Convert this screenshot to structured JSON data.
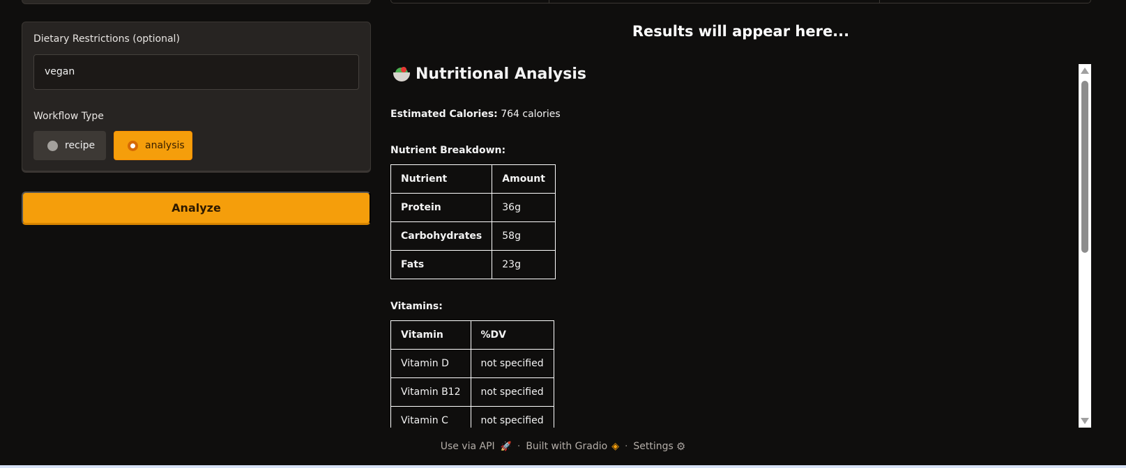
{
  "form": {
    "dietary_label": "Dietary Restrictions (optional)",
    "dietary_value": "vegan",
    "workflow_label": "Workflow Type",
    "workflow_options": [
      "recipe",
      "analysis"
    ],
    "workflow_selected": "analysis",
    "analyze_label": "Analyze"
  },
  "results": {
    "heading": "Results will appear here...",
    "title": "Nutritional Analysis",
    "calories_label": "Estimated Calories:",
    "calories_value": "764 calories",
    "nutrients_label": "Nutrient Breakdown:",
    "nutrients_headers": [
      "Nutrient",
      "Amount"
    ],
    "nutrients_rows": [
      [
        "Protein",
        "36g"
      ],
      [
        "Carbohydrates",
        "58g"
      ],
      [
        "Fats",
        "23g"
      ]
    ],
    "vitamins_label": "Vitamins:",
    "vitamins_headers": [
      "Vitamin",
      "%DV"
    ],
    "vitamins_rows": [
      [
        "Vitamin D",
        "not specified"
      ],
      [
        "Vitamin B12",
        "not specified"
      ],
      [
        "Vitamin C",
        "not specified"
      ]
    ]
  },
  "footer": {
    "api_label": "Use via API",
    "built_label": "Built with Gradio",
    "settings_label": "Settings",
    "separator": "·"
  },
  "colors": {
    "accent": "#f59e0b",
    "background": "#0f0e0d",
    "panel": "#272422"
  },
  "icons": {
    "title_icon": "salad-bowl-icon",
    "api_icon": "rocket-icon",
    "gradio_icon": "gradio-logo-icon",
    "settings_icon": "gear-icon"
  }
}
